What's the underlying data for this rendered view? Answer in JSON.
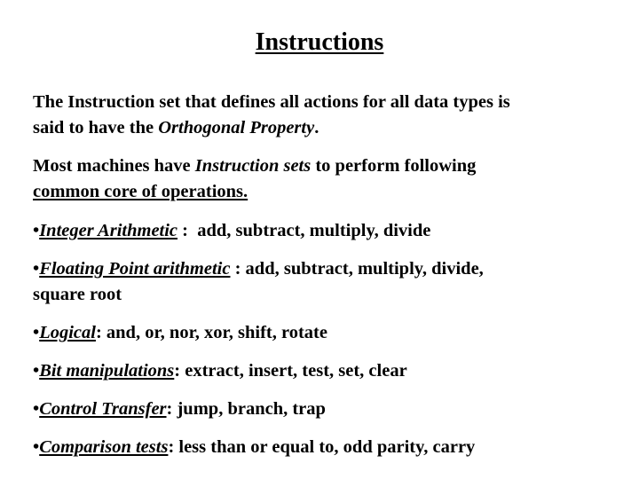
{
  "title": "Instructions",
  "intro": {
    "p1_before": "The Instruction set that defines all actions for all data types is",
    "p1_line2_before": "said to have the ",
    "p1_emph": "Orthogonal Property",
    "p1_after": ".",
    "p2_before": "Most machines have ",
    "p2_emph": "Instruction sets",
    "p2_after": " to perform following",
    "p2_line2": "common core of operations."
  },
  "bullet_char": "•",
  "bullets": [
    {
      "term": "Integer Arithmetic",
      "sep": " :  ",
      "ops": "add, subtract, multiply, divide"
    },
    {
      "term": "Floating Point arithmetic",
      "sep": " : ",
      "ops": "add, subtract, multiply, divide,",
      "ops_line2": "square root"
    },
    {
      "term": "Logical",
      "sep": ": ",
      "ops": "and, or, nor, xor, shift, rotate"
    },
    {
      "term": "Bit manipulations",
      "sep": ": ",
      "ops": "extract, insert, test, set, clear"
    },
    {
      "term": "Control Transfer",
      "sep": ": ",
      "ops": "jump, branch, trap"
    },
    {
      "term": "Comparison tests",
      "sep": ": ",
      "ops": "less than or equal to, odd parity, carry"
    }
  ]
}
